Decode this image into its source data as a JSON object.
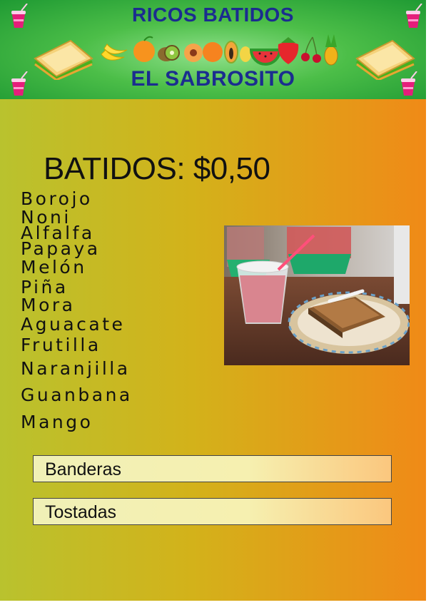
{
  "header": {
    "title_top": "RICOS BATIDOS",
    "title_bottom": "EL SABROSITO",
    "icons": [
      "drink-cup-icon",
      "sandwich-icon",
      "banana-icon",
      "orange-icon",
      "kiwi-icon",
      "peach-icon",
      "papaya-icon",
      "watermelon-icon",
      "strawberry-icon",
      "cherry-icon",
      "pineapple-icon"
    ]
  },
  "menu": {
    "headline": "BATIDOS: $0,50",
    "flavors": [
      "Borojo",
      "Noni",
      "Alfalfa",
      "Papaya",
      "Melón",
      "Piña",
      "Mora",
      "Aguacate",
      "Frutilla",
      "Naranjilla",
      "Guanbana",
      "Mango"
    ]
  },
  "extras": [
    "Banderas",
    "Tostadas"
  ],
  "colors": {
    "title": "#1b2d8f",
    "header_green": "#3db543",
    "bg_left": "#b9c22e",
    "bg_right": "#f08a17"
  }
}
